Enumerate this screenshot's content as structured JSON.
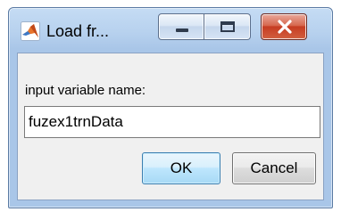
{
  "window": {
    "title": "Load fr..."
  },
  "titlebar_buttons": {
    "minimize_icon": "minimize-icon",
    "maximize_icon": "maximize-icon",
    "close_icon": "close-icon"
  },
  "dialog": {
    "prompt": "input variable name:",
    "input_value": "fuzex1trnData",
    "ok_label": "OK",
    "cancel_label": "Cancel"
  },
  "colors": {
    "frame": "#a9c6e8",
    "close_button": "#c63c22",
    "default_button_border": "#3c7fb1",
    "client_background": "#f0f0f0"
  },
  "icons": {
    "app_icon": "matlab-logo-icon"
  }
}
